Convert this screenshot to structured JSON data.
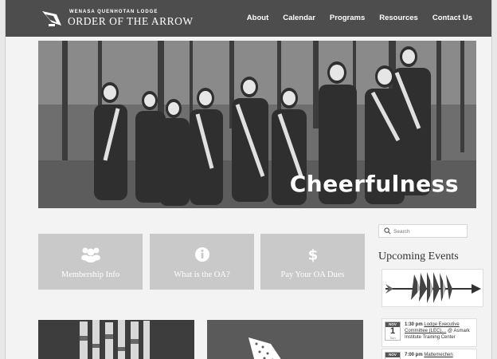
{
  "header": {
    "lodge_name": "WENASA QUENHOTAN LODGE",
    "site_title": "ORDER OF THE ARROW",
    "nav": [
      {
        "label": "About"
      },
      {
        "label": "Calendar"
      },
      {
        "label": "Programs"
      },
      {
        "label": "Resources"
      },
      {
        "label": "Contact Us"
      }
    ]
  },
  "hero": {
    "caption": "Cheerfulness",
    "image": "group-of-scouts-photo"
  },
  "tiles": [
    {
      "label": "Membership Info",
      "icon": "people-icon"
    },
    {
      "label": "What is the OA?",
      "icon": "info-icon"
    },
    {
      "label": "Pay Your OA Dues",
      "icon": "dollar-icon"
    }
  ],
  "sidebar": {
    "search_placeholder": "Search",
    "upcoming_title": "Upcoming Events",
    "events": [
      {
        "month": "NOV",
        "day": "1",
        "weekday": "Sun",
        "time": "1:30 pm",
        "title": "Lodge Executive Committee (LEC)…",
        "location": "@ Asmark Institute Training Center"
      },
      {
        "month": "NOV",
        "day": "",
        "weekday": "",
        "time": "7:00 pm",
        "title": "Mattemechen",
        "location": ""
      }
    ]
  },
  "colors": {
    "header_bg": "#4d4d4d",
    "tile_bg": "#c9c9c9",
    "page_bg": "#f3f3f3"
  }
}
